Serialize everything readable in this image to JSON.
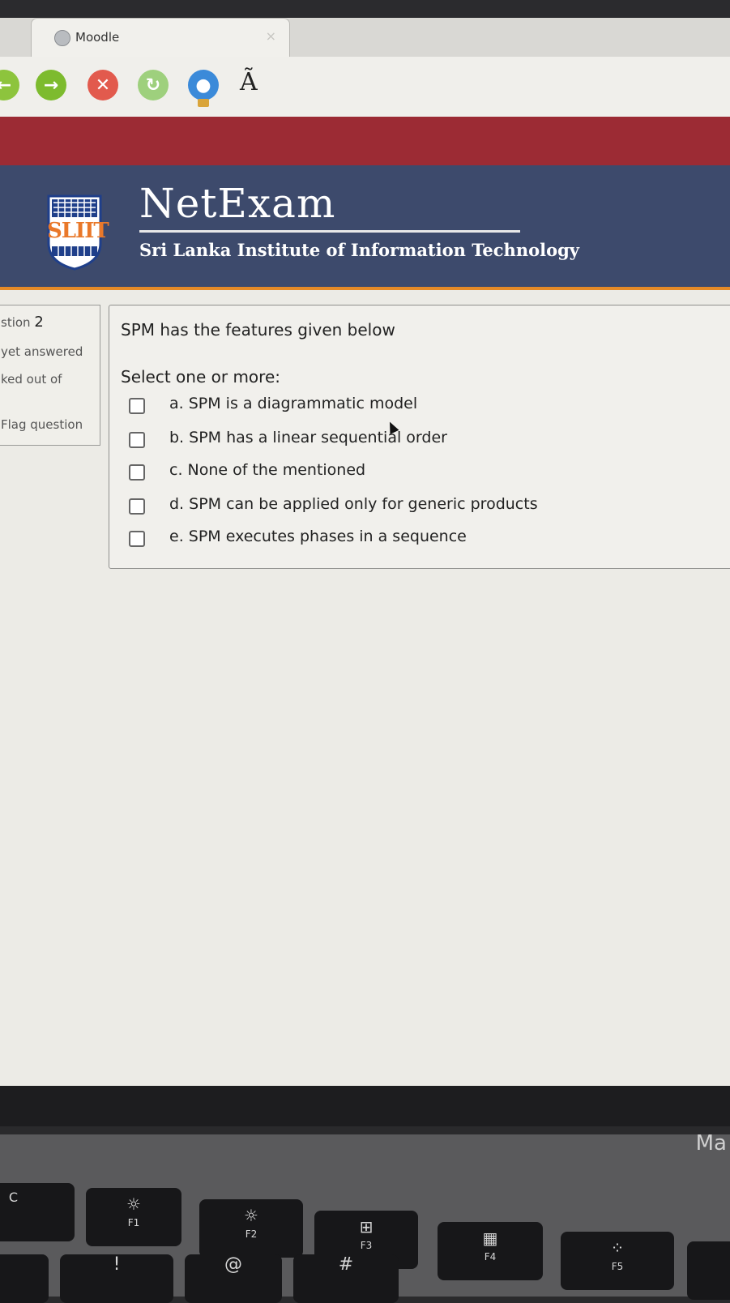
{
  "browser": {
    "tab_title": "Moodle",
    "tab_close": "×",
    "charset_glyph": "Ã",
    "buttons": {
      "back": "←",
      "forward": "→",
      "stop": "✕",
      "reload": "↻",
      "home": "●"
    }
  },
  "header": {
    "logo_text": "SLIIT",
    "brand": "NetExam",
    "institute": "Sri Lanka Institute of Information Technology"
  },
  "question_info": {
    "number_label": "stion",
    "number": "2",
    "state": "yet answered",
    "marks": "ked out of",
    "flag": "Flag question"
  },
  "question": {
    "text": "SPM has the features given below",
    "prompt": "Select one or more:",
    "options": [
      "a. SPM is a diagrammatic model",
      "b. SPM has a linear sequential order",
      "c. None of the mentioned",
      "d. SPM can be applied only for generic products",
      "e. SPM executes phases in a sequence"
    ]
  },
  "laptop": {
    "brand_partial": "Ma",
    "keys": {
      "esc": "C",
      "f1_glyph": "☼",
      "f1": "F1",
      "f2_glyph": "☼",
      "f2": "F2",
      "f3_glyph": "⊞",
      "f3": "F3",
      "f4_glyph": "▦",
      "f4": "F4",
      "f5_glyph": "⁘",
      "f5": "F5",
      "excl": "!",
      "at": "@",
      "hash": "#"
    }
  }
}
